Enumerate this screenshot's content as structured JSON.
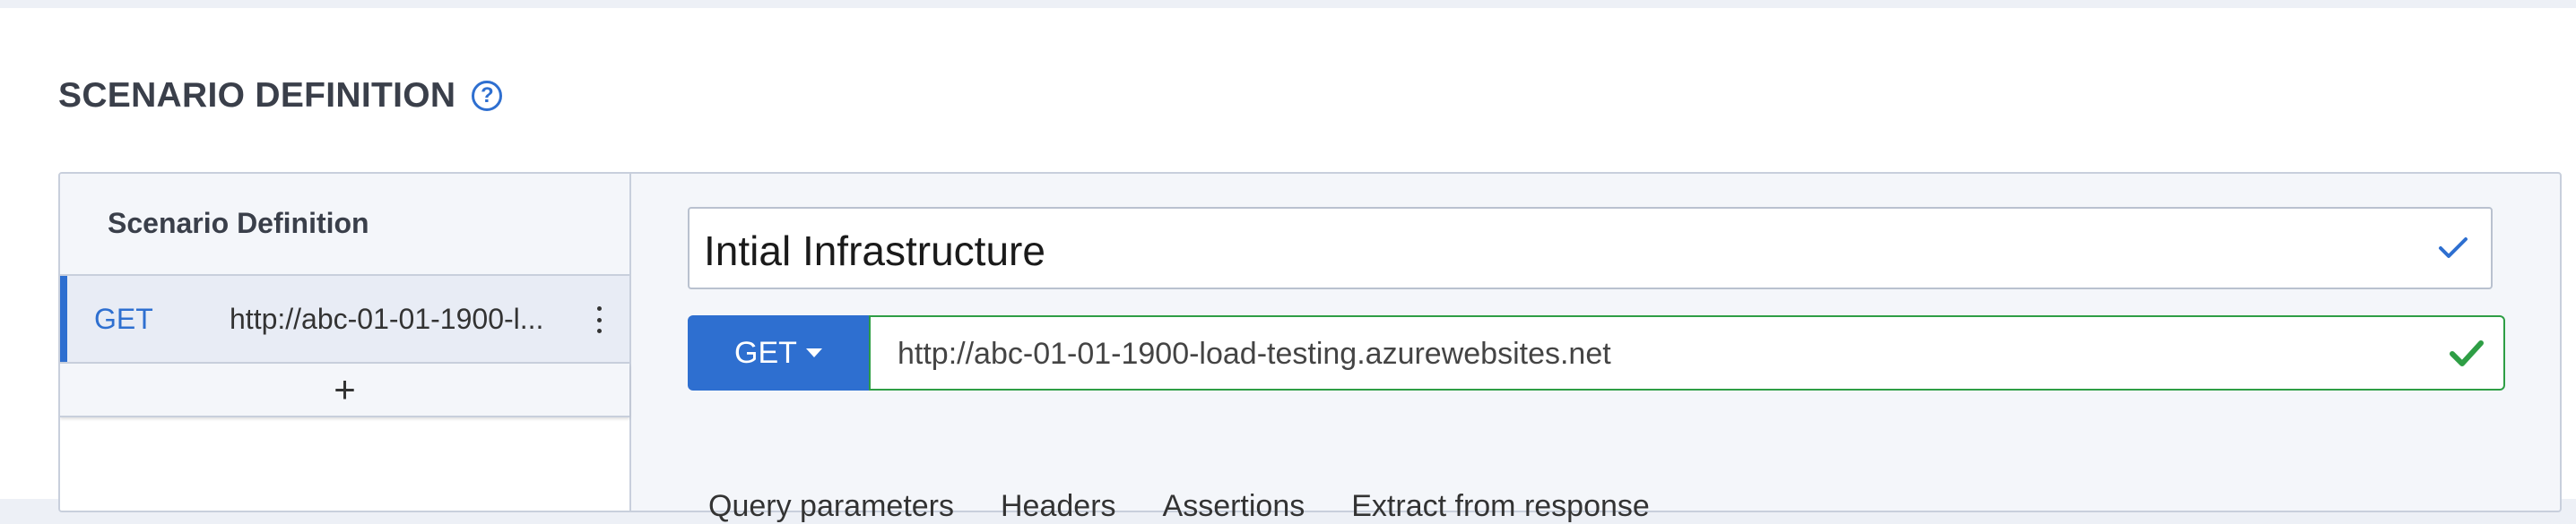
{
  "section": {
    "title": "SCENARIO DEFINITION",
    "help_icon": "question-circle-icon"
  },
  "left_panel": {
    "header": "Scenario Definition",
    "requests": [
      {
        "method": "GET",
        "url": "http://abc-01-01-1900-l...",
        "menu_icon": "kebab-menu-icon"
      }
    ],
    "add_label": "+"
  },
  "request_editor": {
    "name_value": "Intial Infrastructure",
    "method_label": "GET",
    "url_value": "http://abc-01-01-1900-load-testing.azurewebsites.net",
    "tabs": [
      "Query parameters",
      "Headers",
      "Assertions",
      "Extract from response"
    ]
  },
  "colors": {
    "accent": "#2e6fd0",
    "valid": "#2e9e45"
  }
}
